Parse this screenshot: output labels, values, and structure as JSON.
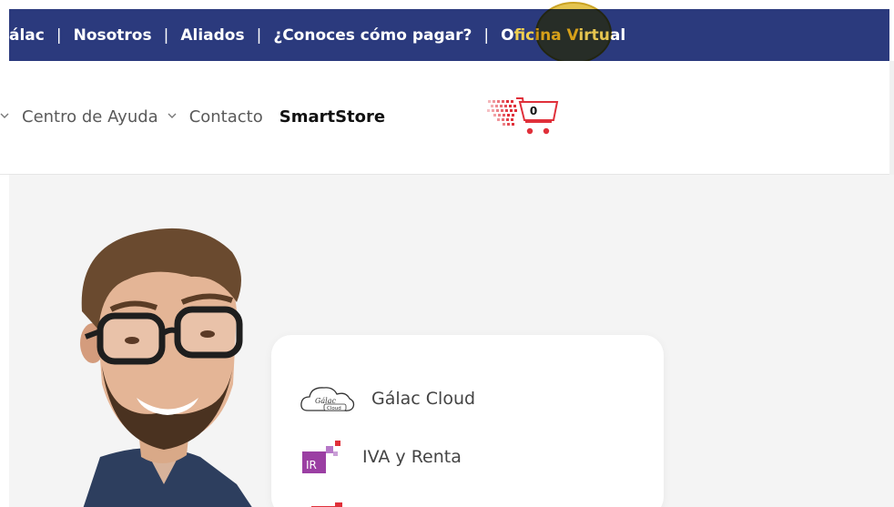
{
  "topbar": {
    "links": [
      {
        "label": "álac"
      },
      {
        "label": "Nosotros"
      },
      {
        "label": "Aliados"
      },
      {
        "label": "¿Conoces cómo pagar?"
      }
    ],
    "separator": "|",
    "oficina_part1": "O",
    "oficina_part2": "ficina V",
    "oficina_part3": "irtual",
    "colors": {
      "background": "#2b3a7d",
      "text": "#ffffff",
      "cursor_highlight": "#deb728"
    }
  },
  "nav": {
    "items": [
      {
        "label": "Centro de Ayuda",
        "dropdown": true
      },
      {
        "label": "Contacto",
        "dropdown": false
      }
    ],
    "smartstore_label": "SmartStore",
    "cart_count": "0",
    "cart_icon": "shopping-cart-icon",
    "colors": {
      "cart": "#e0303a"
    }
  },
  "hero": {
    "card": {
      "items": [
        {
          "label": "Gálac Cloud",
          "icon": "galac-cloud-icon"
        },
        {
          "label": "IVA y Renta",
          "icon": "ir-icon",
          "icon_text": "IR"
        }
      ],
      "cloud_logo_text": "Gálac",
      "cloud_logo_subtext": "Cloud"
    },
    "colors": {
      "background": "#f4f4f4",
      "card": "#ffffff",
      "ir_icon": "#9b3fa3"
    }
  }
}
